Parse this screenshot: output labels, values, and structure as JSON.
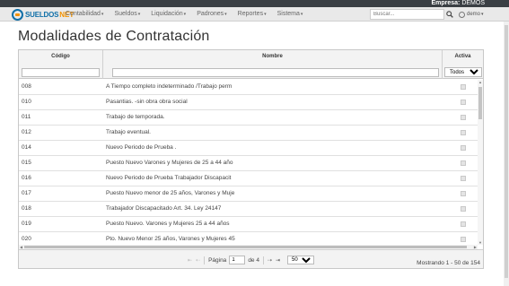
{
  "topbar": {
    "empresa_label": "Empresa:",
    "empresa_value": "DEMOS"
  },
  "brand": {
    "part1": "SUELDOS",
    "part2": "NET"
  },
  "nav": [
    {
      "label": "Contabilidad"
    },
    {
      "label": "Sueldos"
    },
    {
      "label": "Liquidación"
    },
    {
      "label": "Padrones"
    },
    {
      "label": "Reportes"
    },
    {
      "label": "Sistema"
    }
  ],
  "search": {
    "placeholder": "Buscar..."
  },
  "user": {
    "name": "demo"
  },
  "page": {
    "title": "Modalidades de Contratación"
  },
  "grid": {
    "columns": {
      "codigo": "Código",
      "nombre": "Nombre",
      "activa": "Activa"
    },
    "filter_activa_selected": "Todos",
    "rows": [
      {
        "codigo": "008",
        "nombre": "A Tiempo completo indeterminado /Trabajo perm"
      },
      {
        "codigo": "010",
        "nombre": "Pasantias. -sin obra obra social"
      },
      {
        "codigo": "011",
        "nombre": "Trabajo de temporada."
      },
      {
        "codigo": "012",
        "nombre": "Trabajo eventual."
      },
      {
        "codigo": "014",
        "nombre": "Nuevo Periodo de Prueba ."
      },
      {
        "codigo": "015",
        "nombre": "Puesto Nuevo Varones y Mujeres de 25 a 44 año"
      },
      {
        "codigo": "016",
        "nombre": "Nuevo Periodo de Prueba Trabajador Discapacit"
      },
      {
        "codigo": "017",
        "nombre": "Puesto Nuevo menor de 25 años, Varones y Muje"
      },
      {
        "codigo": "018",
        "nombre": "Trabajador Discapacitado Art. 34. Ley 24147"
      },
      {
        "codigo": "019",
        "nombre": "Puesto Nuevo. Varones y Mujeres 25 a 44 años"
      },
      {
        "codigo": "020",
        "nombre": "Pto. Nuevo Menor 25 años, Varones y Mujeres 45"
      }
    ]
  },
  "pager": {
    "page_label": "Página",
    "page_value": "1",
    "of_label": "de 4",
    "per_page": "50",
    "records_text": "Mostrando 1 - 50 de 154"
  },
  "colors": {
    "topbar": "#3a3f44",
    "brand_blue": "#0f6fa8",
    "brand_orange": "#f39200",
    "navbar": "#e9e9e9"
  },
  "icons": {
    "search": "search-icon",
    "user": "user-icon",
    "logo": "logo-icon"
  }
}
